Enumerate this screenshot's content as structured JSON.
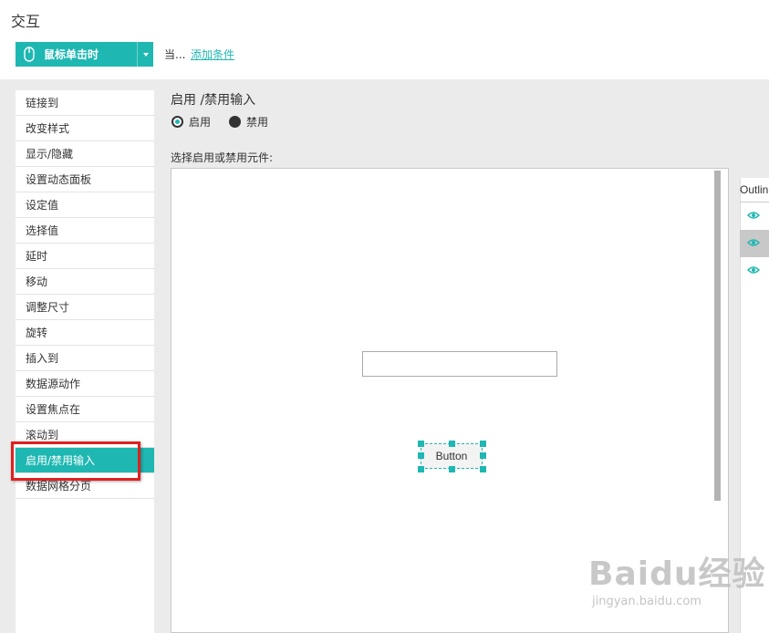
{
  "window": {
    "title": "交互"
  },
  "event": {
    "label": "鼠标单击时",
    "when_text": "当...",
    "add_condition": "添加条件"
  },
  "actions": [
    {
      "label": "链接到"
    },
    {
      "label": "改变样式"
    },
    {
      "label": "显示/隐藏"
    },
    {
      "label": "设置动态面板"
    },
    {
      "label": "设定值"
    },
    {
      "label": "选择值"
    },
    {
      "label": "延时"
    },
    {
      "label": "移动"
    },
    {
      "label": "调整尺寸"
    },
    {
      "label": "旋转"
    },
    {
      "label": "插入到"
    },
    {
      "label": "数据源动作"
    },
    {
      "label": "设置焦点在"
    },
    {
      "label": "滚动到"
    },
    {
      "label": "启用/禁用输入",
      "selected": true
    },
    {
      "label": "数据网格分页"
    }
  ],
  "config": {
    "title": "启用 /禁用输入",
    "enable_label": "启用",
    "disable_label": "禁用",
    "selected_option": "启用",
    "choose_label": "选择启用或禁用元件:"
  },
  "canvas": {
    "button_label": "Button"
  },
  "outline": {
    "label": "Outlin"
  },
  "watermark": {
    "brand": "Baidu经验",
    "url": "jingyan.baidu.com"
  },
  "colors": {
    "accent": "#1fb7b2",
    "highlight": "#e02020",
    "band": "#ebebeb"
  }
}
